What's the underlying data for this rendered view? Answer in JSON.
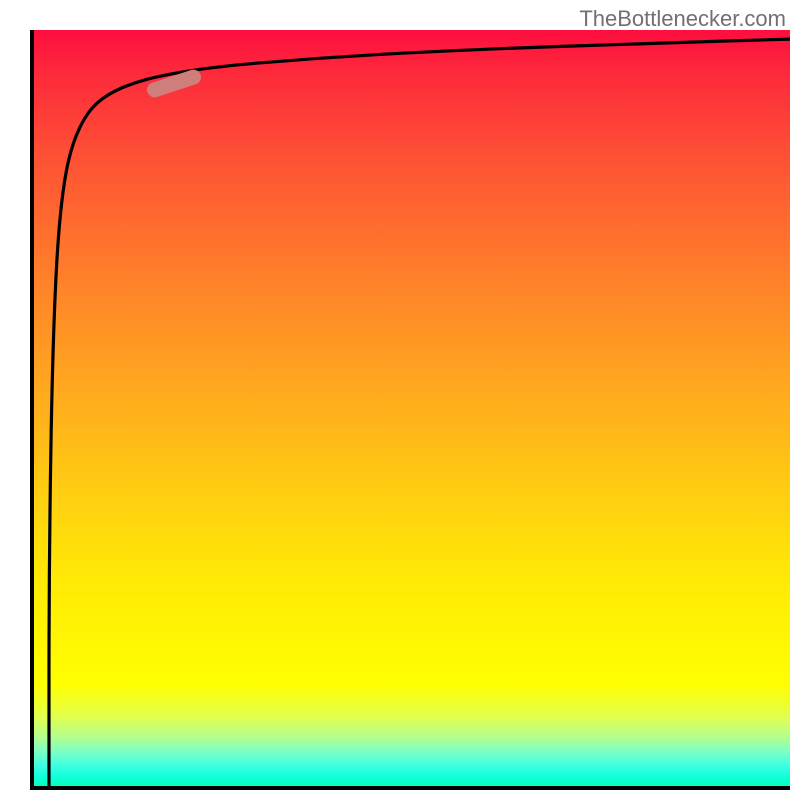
{
  "watermark": {
    "text": "TheBottlenecker.com"
  },
  "chart_data": {
    "type": "line",
    "title": "",
    "xlabel": "",
    "ylabel": "",
    "xlim": [
      0,
      100
    ],
    "ylim": [
      0,
      100
    ],
    "background_gradient": {
      "direction": "vertical",
      "stops": [
        {
          "pos": 0.0,
          "color": "#fd0e3f"
        },
        {
          "pos": 0.33,
          "color": "#ff8129"
        },
        {
          "pos": 0.6,
          "color": "#ffcb12"
        },
        {
          "pos": 0.86,
          "color": "#ffff00"
        },
        {
          "pos": 1.0,
          "color": "#00ffb4"
        }
      ]
    },
    "series": [
      {
        "name": "bottleneck-curve",
        "stroke": "#000000",
        "points": [
          {
            "x": 2.5,
            "y": 0.5
          },
          {
            "x": 2.5,
            "y": 30
          },
          {
            "x": 3.0,
            "y": 60
          },
          {
            "x": 4.0,
            "y": 78
          },
          {
            "x": 6.0,
            "y": 87
          },
          {
            "x": 10.0,
            "y": 92
          },
          {
            "x": 20.0,
            "y": 94.8
          },
          {
            "x": 40.0,
            "y": 96.5
          },
          {
            "x": 60.0,
            "y": 97.5
          },
          {
            "x": 80.0,
            "y": 98.2
          },
          {
            "x": 100.0,
            "y": 98.8
          }
        ]
      }
    ],
    "marker": {
      "name": "highlight-segment",
      "x": 19,
      "y": 93,
      "color": "#cf7f7b",
      "shape": "pill",
      "rotation_deg": -18
    }
  }
}
